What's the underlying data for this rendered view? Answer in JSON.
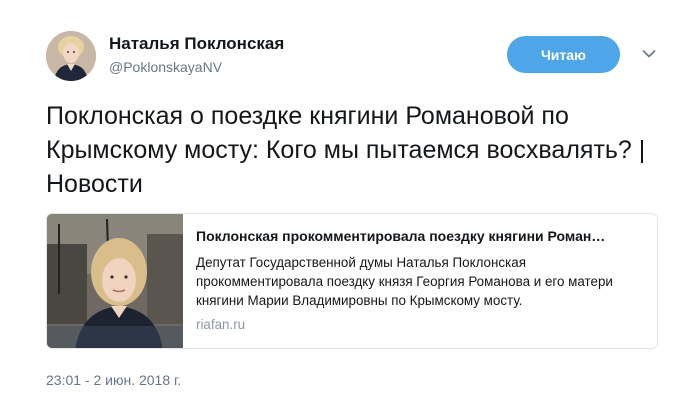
{
  "user": {
    "name": "Наталья Поклонская",
    "handle": "@PoklonskayaNV",
    "avatar_icon": "profile-photo"
  },
  "follow_button": {
    "label": "Читаю",
    "color": "#4ea6e9"
  },
  "menu_icon": "chevron-down-icon",
  "tweet": {
    "text": "Поклонская о поездке княгини Романовой по Крымскому мосту: Кого мы пытаемся восхвалять? | Новости",
    "timestamp": "23:01 - 2 июн. 2018 г."
  },
  "card": {
    "title": "Поклонская прокомментировала поездку княгини Роман…",
    "description": "Депутат Государственной думы Наталья Поклонская прокомментировала поездку князя Георгия Романова и его матери княгини Марии Владимировны по Крымскому мосту.",
    "domain": "riafan.ru"
  }
}
